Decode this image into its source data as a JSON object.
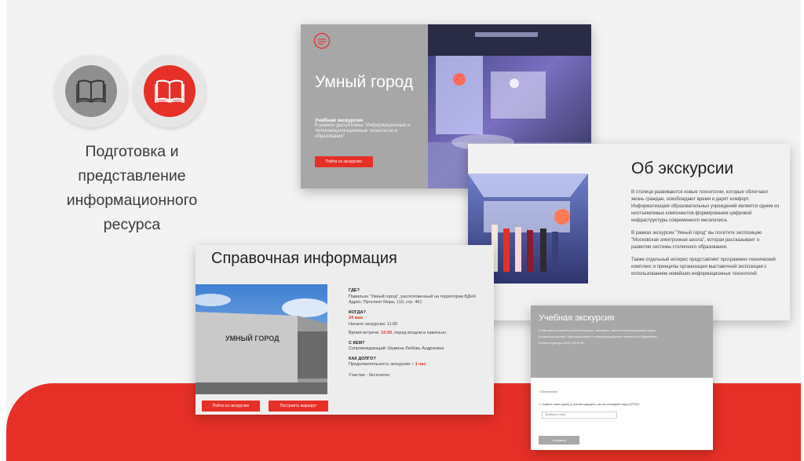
{
  "left_panel": {
    "title": "Подготовка и представление информационного ресурса",
    "icons": [
      "book-icon",
      "book-open-icon"
    ]
  },
  "card_smart_city": {
    "title": "Умный город",
    "label": "Учебная экскурсия",
    "description": "В рамках дисциплины \"Информационные и телекоммуникационные технологии в образовании\"",
    "button": "Пойти на экскурсию"
  },
  "card_about": {
    "title": "Об экскурсии",
    "paragraphs": [
      "В столице развиваются новые технологии, которые облегчают жизнь граждан, освобождают время и дарят комфорт. Информатизация образовательных учреждений является одним из неотъемлемых компонентов формирования цифровой инфраструктуры современного мегаполиса.",
      "В рамках экскурсии \"Умный город\" вы посетите экспозицию \"Московская электронная школа\", которая рассказывает о развитии системы столичного образования.",
      "Также отдельный интерес представляет программно-технический комплекс и принципы организации выставочной экспозиции с использованием новейших информационных технологий."
    ]
  },
  "card_reference": {
    "title": "Справочная информация",
    "building_sign": "УМНЫЙ ГОРОД",
    "button_go": "Пойти на экскурсию",
    "button_route": "Построить маршрут",
    "where_q": "ГДЕ?",
    "where_a": "Павильон \"Умный город\", расположенный на территории ВДНХ",
    "address": "Адрес: Проспект Мира, 119, стр. 461",
    "when_q": "КОГДА?",
    "when_date": "24 мая",
    "start_time": "Начало экскурсии: 11:00",
    "meet_prefix": "Время встречи:",
    "meet_time": "10:50",
    "meet_suffix": ", перед входом в павильон",
    "with_q": "С КЕМ?",
    "with_a": "Сопровождающий: Шумина Любовь Андреевна",
    "long_q": "КАК ДОЛГО?",
    "long_prefix": "Продолжительность экскурсии",
    "long_value": "~ 1 час",
    "price": "Участие - бесплатно"
  },
  "card_form": {
    "title": "Учебная экскурсия",
    "intro": "Чтобы принять участие в учебной экскурсии, пожалуйста, заполните регистрационную форму.",
    "intro2": "В рамках дисциплины \"Информационные и телекоммуникационные технологии в образовании\".",
    "intro3": "Контакты куратора: 8(911) 000-00-00",
    "required": "* Обязательно",
    "question": "1. Укажите свою группу (с учетом подгрупп), как вы посещаете пары (ИТТО) *",
    "select_placeholder": "Выберите ответ",
    "submit": "Отправить"
  }
}
